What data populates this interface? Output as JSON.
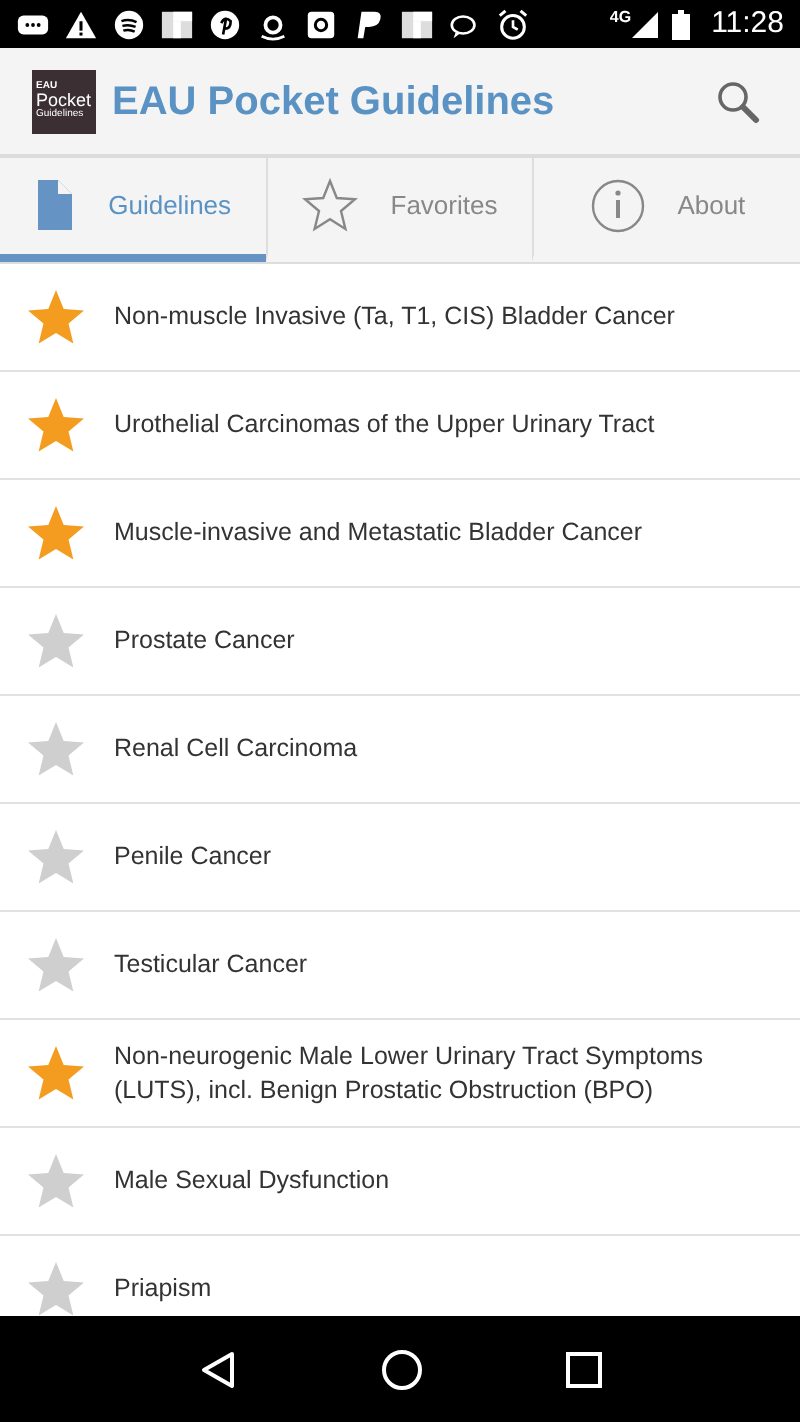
{
  "status_bar": {
    "network": "4G",
    "time": "11:28"
  },
  "app_bar": {
    "logo_lines": [
      "EAU",
      "Pocket",
      "Guidelines"
    ],
    "title": "EAU Pocket Guidelines"
  },
  "tabs": [
    {
      "label": "Guidelines",
      "kind": "document",
      "selected": true
    },
    {
      "label": "Favorites",
      "kind": "star",
      "selected": false
    },
    {
      "label": "About",
      "kind": "info",
      "selected": false
    }
  ],
  "guidelines": [
    {
      "title": "Non-muscle Invasive (Ta, T1, CIS)  Bladder Cancer",
      "favorite": true
    },
    {
      "title": "Urothelial Carcinomas of the Upper Urinary Tract",
      "favorite": true
    },
    {
      "title": "Muscle-invasive and Metastatic Bladder Cancer",
      "favorite": true
    },
    {
      "title": "Prostate Cancer",
      "favorite": false
    },
    {
      "title": "Renal Cell Carcinoma",
      "favorite": false
    },
    {
      "title": "Penile Cancer",
      "favorite": false
    },
    {
      "title": "Testicular Cancer",
      "favorite": false
    },
    {
      "title": "Non-neurogenic Male Lower Urinary Tract Symptoms (LUTS), incl. Benign Prostatic Obstruction (BPO)",
      "favorite": true
    },
    {
      "title": "Male Sexual Dysfunction",
      "favorite": false
    },
    {
      "title": "Priapism",
      "favorite": false
    }
  ]
}
